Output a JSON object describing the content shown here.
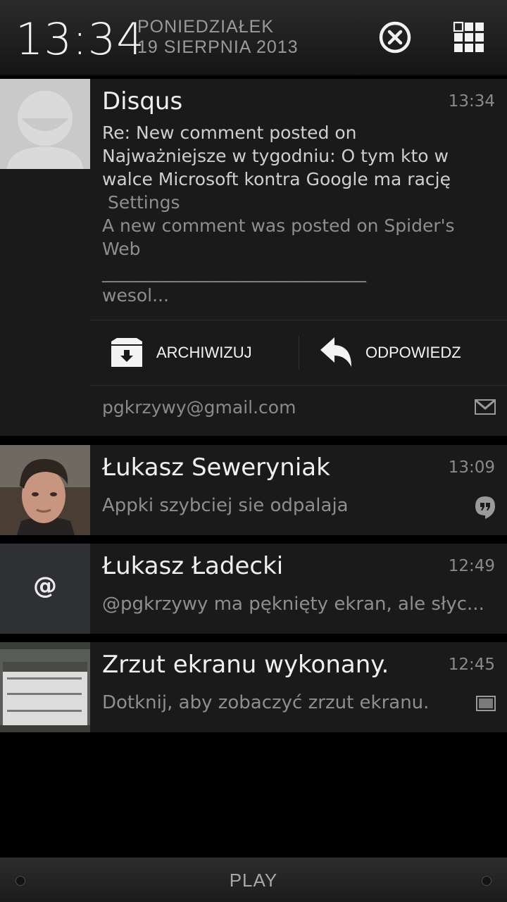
{
  "header": {
    "time": "13:34",
    "weekday": "PONIEDZIAŁEK",
    "date": "19 SIERPNIA 2013",
    "clear_icon": "clear-all-icon",
    "settings_icon": "quick-settings-grid-icon"
  },
  "notifications": [
    {
      "app": "Disqus",
      "time": "13:34",
      "lines": [
        "Re: New comment posted on",
        "Najważniejsze w tygodniu: O tym kto w",
        "walce Microsoft kontra Google ma rację",
        " Settings",
        "A new comment was posted on Spider's",
        "Web",
        "______________________________",
        "wesol..."
      ],
      "actions": [
        {
          "label": "ARCHIWIZUJ",
          "icon": "archive-icon"
        },
        {
          "label": "ODPOWIEDZ",
          "icon": "reply-icon"
        }
      ],
      "account": "pgkrzywy@gmail.com",
      "footer_icon": "gmail-icon"
    },
    {
      "title": "Łukasz Seweryniak",
      "time": "13:09",
      "text": "Appki szybciej sie odpalaja",
      "icon": "hangouts-icon"
    },
    {
      "title": "Łukasz Ładecki",
      "time": "12:49",
      "text": "@pgkrzywy ma pęknięty ekran, ale słyc...",
      "avatar_glyph": "@"
    },
    {
      "title": "Zrzut ekranu wykonany.",
      "time": "12:45",
      "text": "Dotknij, aby zobaczyć zrzut ekranu.",
      "icon": "image-icon"
    }
  ],
  "bottom": {
    "label": "PLAY"
  },
  "colors": {
    "background": "#000000",
    "card": "#1a1a1a",
    "text_dim": "#8e8e8e"
  }
}
